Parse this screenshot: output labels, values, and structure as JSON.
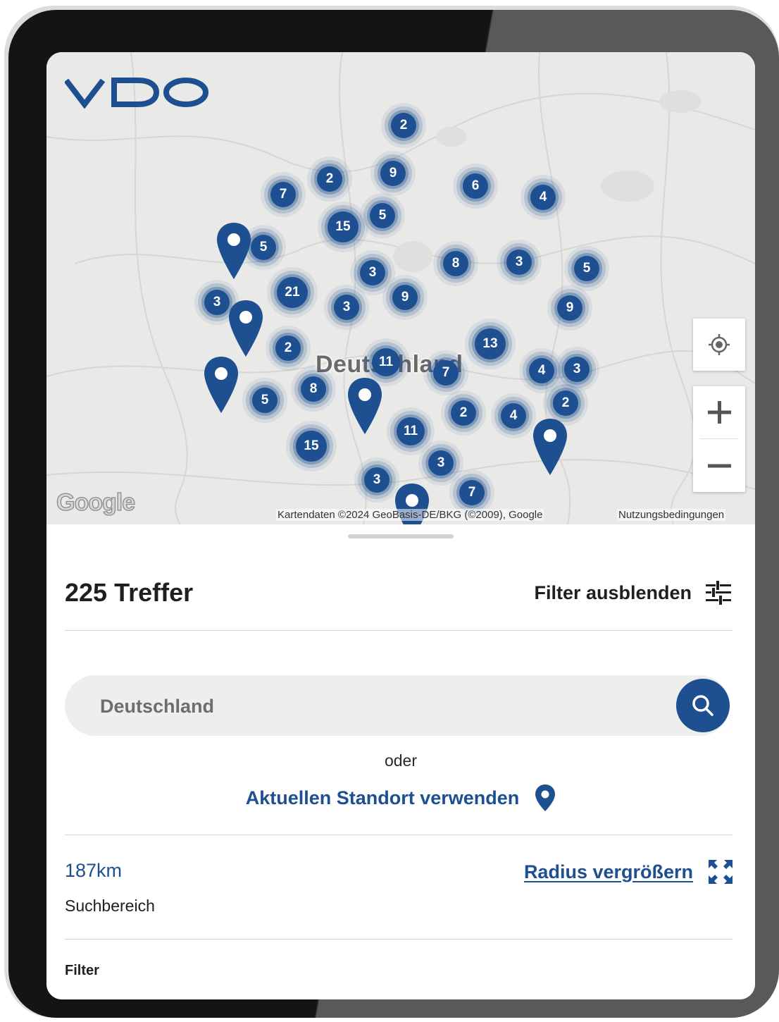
{
  "brand": {
    "name": "VDO",
    "color": "#1d4f91"
  },
  "map": {
    "country_label": "Deutschland",
    "google_logo": "Google",
    "attribution": "Kartendaten ©2024 GeoBasis-DE/BKG (©2009), Google",
    "terms": "Nutzungsbedingungen",
    "clusters": [
      "2",
      "7",
      "2",
      "9",
      "6",
      "4",
      "15",
      "5",
      "5",
      "8",
      "3",
      "5",
      "3",
      "21",
      "3",
      "9",
      "3",
      "9",
      "2",
      "13",
      "11",
      "7",
      "4",
      "3",
      "5",
      "8",
      "2",
      "4",
      "2",
      "15",
      "11",
      "3",
      "3",
      "7"
    ],
    "controls": {
      "locate": "locate-icon",
      "zoom_in": "+",
      "zoom_out": "−"
    }
  },
  "results": {
    "count_label": "225 Treffer",
    "filter_toggle_label": "Filter ausblenden"
  },
  "search": {
    "placeholder": "Deutschland",
    "value": "",
    "or_label": "oder",
    "use_location_label": "Aktuellen Standort verwenden"
  },
  "radius": {
    "value": "187km",
    "caption": "Suchbereich",
    "increase_label": "Radius vergrößern"
  },
  "filter": {
    "heading": "Filter"
  }
}
